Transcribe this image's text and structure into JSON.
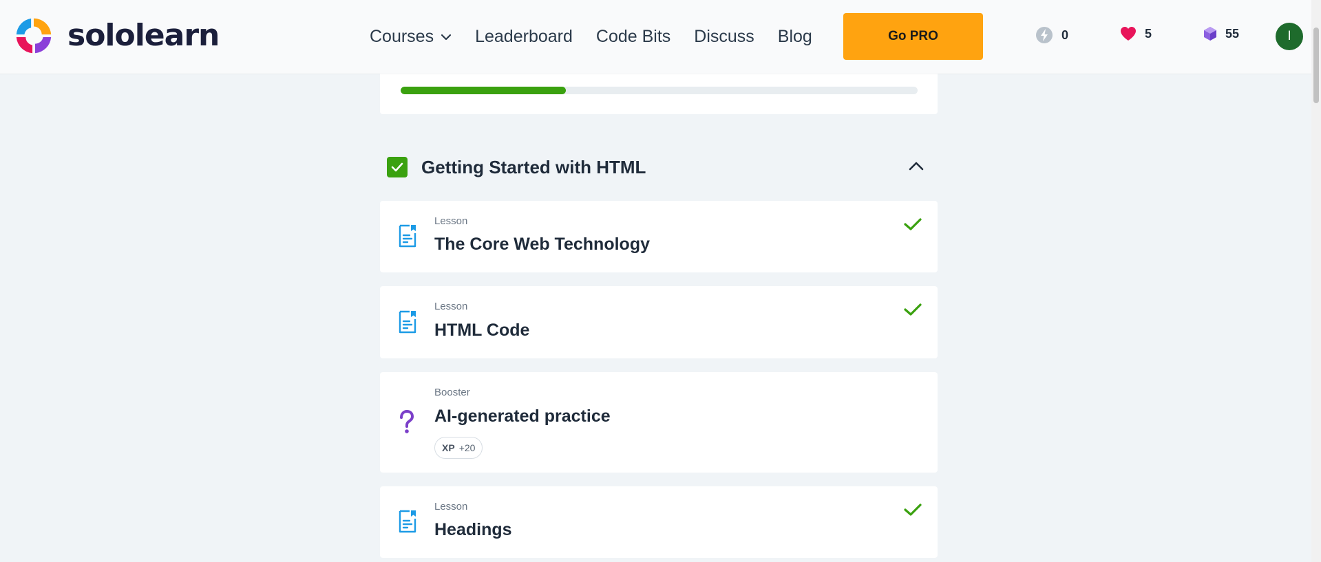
{
  "brand": {
    "name": "sololearn"
  },
  "nav": {
    "items": [
      {
        "label": "Courses",
        "has_dropdown": true
      },
      {
        "label": "Leaderboard"
      },
      {
        "label": "Code Bits"
      },
      {
        "label": "Discuss"
      },
      {
        "label": "Blog"
      }
    ],
    "cta_label": "Go PRO"
  },
  "stats": {
    "streak": "0",
    "hearts": "5",
    "gems": "55"
  },
  "user": {
    "avatar_initial": "I"
  },
  "course_progress": {
    "fraction": 0.32
  },
  "module": {
    "title": "Getting Started with HTML",
    "completed": true,
    "expanded": true
  },
  "items": [
    {
      "kind": "Lesson",
      "title": "The Core Web Technology",
      "completed": true,
      "icon": "lesson-icon"
    },
    {
      "kind": "Lesson",
      "title": "HTML Code",
      "completed": true,
      "icon": "lesson-icon"
    },
    {
      "kind": "Booster",
      "title": "AI-generated practice",
      "completed": false,
      "icon": "question-icon",
      "xp": {
        "label": "XP",
        "value": "+20"
      }
    },
    {
      "kind": "Lesson",
      "title": "Headings",
      "completed": true,
      "icon": "lesson-icon"
    }
  ],
  "colors": {
    "accent_green": "#3aa10f",
    "pro_orange": "#ffa310",
    "lesson_blue": "#1c9be6",
    "booster_purple": "#7b3fc9"
  }
}
